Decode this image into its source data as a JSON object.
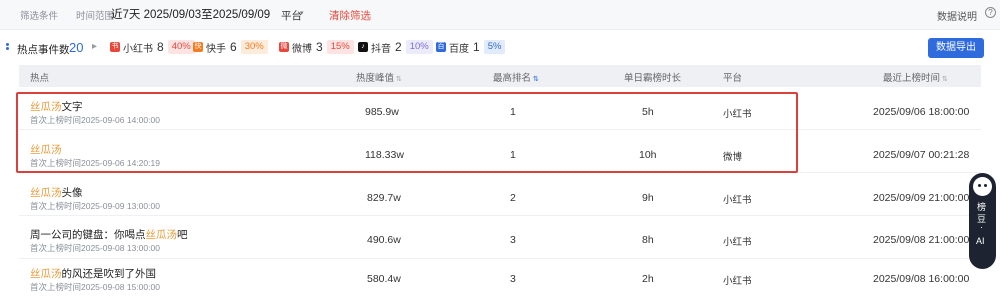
{
  "filter": {
    "label": "筛选条件",
    "time_label": "时间范围",
    "time_value": "近7天  2025/09/03至2025/09/09",
    "platform_label": "平台",
    "clear_label": "清除筛选",
    "help_label": "数据说明",
    "help_glyph": "?"
  },
  "summary": {
    "label": "热点事件数",
    "total": "20",
    "arrow": "▸",
    "platforms": [
      {
        "name": "小红书",
        "count": "8",
        "percent": "40%",
        "icon": "xiaohongshu-icon",
        "color": "#e8483b"
      },
      {
        "name": "快手",
        "count": "6",
        "percent": "30%",
        "icon": "kuaishou-icon",
        "color": "#f47b20"
      },
      {
        "name": "微博",
        "count": "3",
        "percent": "15%",
        "icon": "weibo-icon",
        "color": "#e8483b"
      },
      {
        "name": "抖音",
        "count": "2",
        "percent": "10%",
        "icon": "douyin-icon",
        "color": "#111111"
      },
      {
        "name": "百度",
        "count": "1",
        "percent": "5%",
        "icon": "baidu-icon",
        "color": "#2f6bdc"
      }
    ],
    "export_label": "数据导出"
  },
  "table": {
    "headers": {
      "topic": "热点",
      "heat": "热度峰值",
      "rank": "最高排名",
      "duration": "单日霸榜时长",
      "platform": "平台",
      "last_time": "最近上榜时间"
    },
    "rows": [
      {
        "hl": "丝瓜汤",
        "rest": "文字",
        "first_seen": "首次上榜时间2025-09-06 14:00:00",
        "heat": "985.9w",
        "rank": "1",
        "duration": "5h",
        "platform": "小红书",
        "last_time": "2025/09/06 18:00:00"
      },
      {
        "hl": "丝瓜汤",
        "rest": "",
        "first_seen": "首次上榜时间2025-09-06 14:20:19",
        "heat": "118.33w",
        "rank": "1",
        "duration": "10h",
        "platform": "微博",
        "last_time": "2025/09/07 00:21:28"
      },
      {
        "hl": "丝瓜汤",
        "rest": "头像",
        "first_seen": "首次上榜时间2025-09-09 13:00:00",
        "heat": "829.7w",
        "rank": "2",
        "duration": "9h",
        "platform": "小红书",
        "last_time": "2025/09/09 21:00:00"
      },
      {
        "pre": "周一公司的键盘：你喝点",
        "hl": "丝瓜汤",
        "rest": "吧",
        "first_seen": "首次上榜时间2025-09-08 13:00:00",
        "heat": "490.6w",
        "rank": "3",
        "duration": "8h",
        "platform": "小红书",
        "last_time": "2025/09/08 21:00:00"
      },
      {
        "hl": "丝瓜汤",
        "rest": "的风还是吹到了外国",
        "first_seen": "首次上榜时间2025-09-08 15:00:00",
        "heat": "580.4w",
        "rank": "3",
        "duration": "2h",
        "platform": "小红书",
        "last_time": "2025/09/08 16:00:00"
      }
    ]
  },
  "ai_widget": {
    "line1": "榜",
    "line2": "豆",
    "line3": "·",
    "line4": "AI"
  }
}
